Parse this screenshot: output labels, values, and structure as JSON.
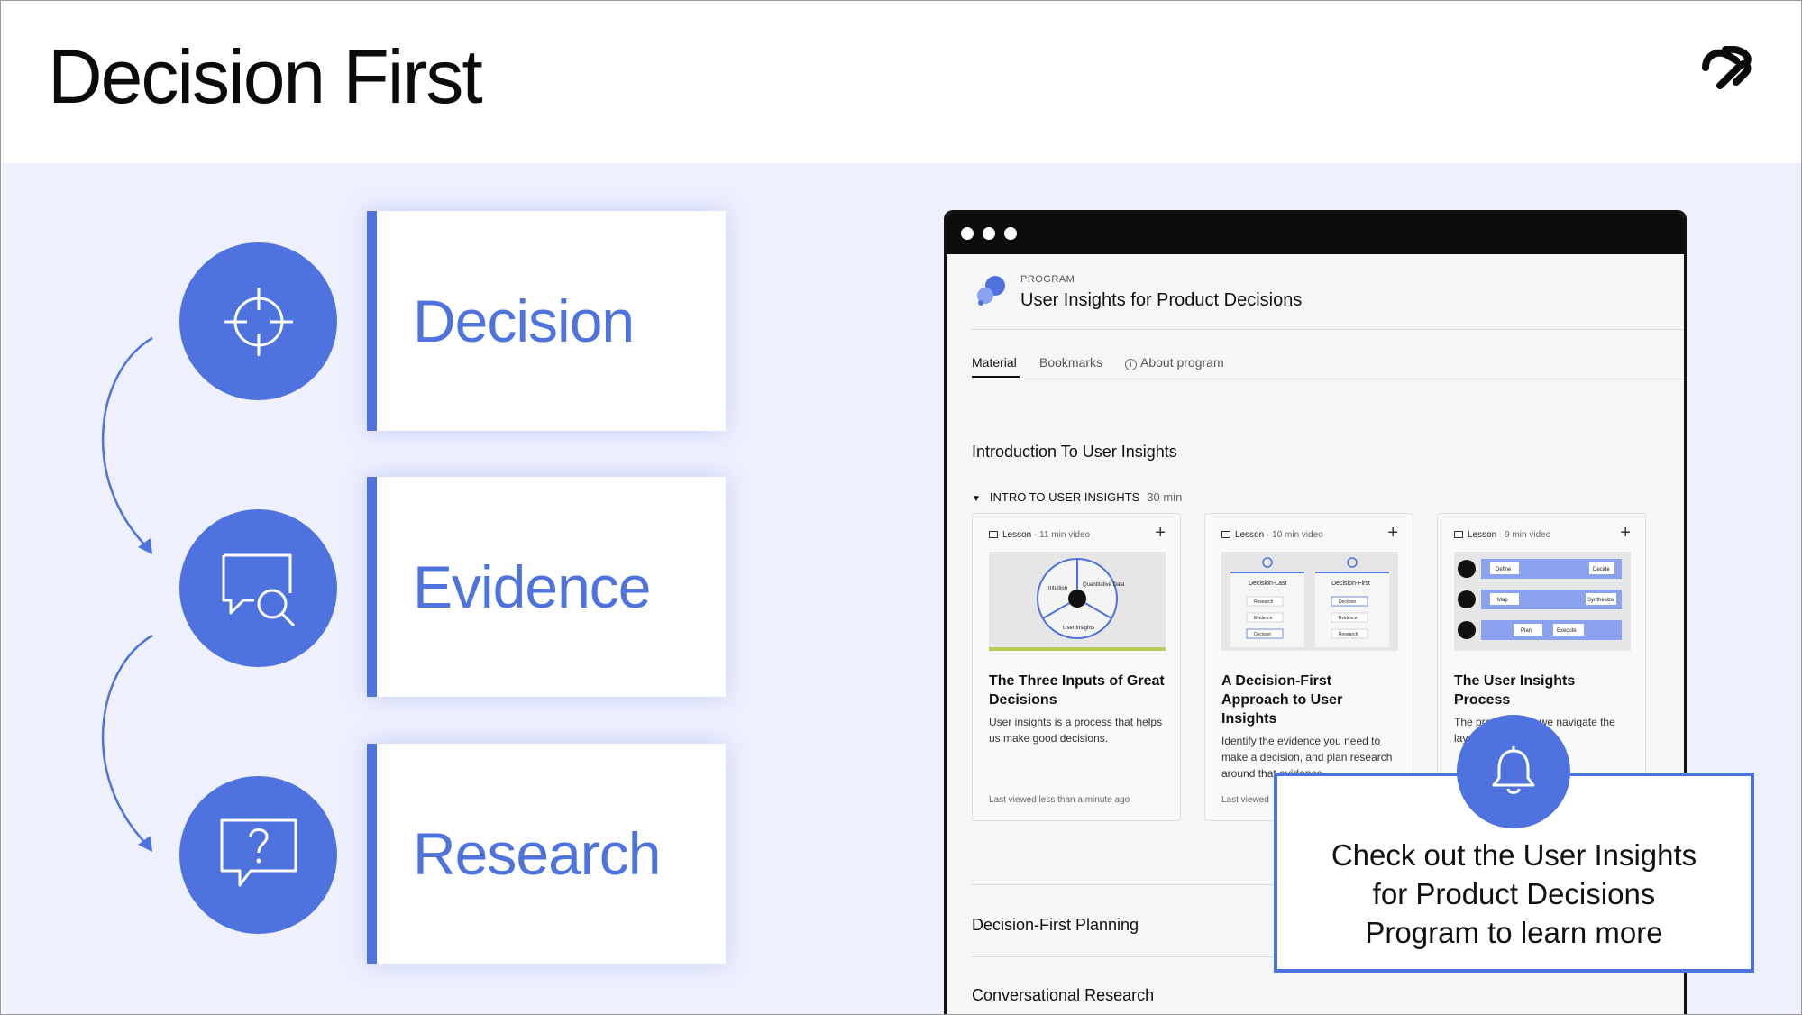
{
  "slide": {
    "title": "Decision First",
    "brand_color": "#4e73de",
    "background_color": "#eef0fd"
  },
  "steps": [
    {
      "label": "Decision",
      "icon": "crosshair-icon"
    },
    {
      "label": "Evidence",
      "icon": "chat-search-icon"
    },
    {
      "label": "Research",
      "icon": "question-chat-icon"
    }
  ],
  "browser": {
    "program_kicker": "PROGRAM",
    "program_title": "User Insights for Product Decisions",
    "tabs": [
      "Material",
      "Bookmarks",
      "About program"
    ],
    "active_tab": "Material",
    "section_title": "Introduction To User Insights",
    "sub_section": {
      "label": "INTRO TO USER INSIGHTS",
      "duration": "30 min"
    },
    "lessons": [
      {
        "kind": "Lesson",
        "length": "· 11 min video",
        "title": "The Three Inputs of Great Decisions",
        "description": "User insights is a process that helps us make good decisions.",
        "footer": "Last viewed less than a minute ago",
        "thumb_labels": [
          "Intuition",
          "Quantitative Data",
          "User Insights"
        ]
      },
      {
        "kind": "Lesson",
        "length": "· 10 min video",
        "title": "A Decision-First Approach to User Insights",
        "description": "Identify the evidence you need to make a decision, and plan research around that evidence.",
        "footer": "Last viewed",
        "thumb_labels": [
          "Decision-Last",
          "Research",
          "Evidence",
          "Decision",
          "Decision-First",
          "Decision",
          "Evidence",
          "Research"
        ]
      },
      {
        "kind": "Lesson",
        "length": "· 9 min video",
        "title": "The User Insights Process",
        "description": "The process how we navigate the layers to user insights.",
        "footer": "",
        "thumb_labels": [
          "Define",
          "Decide",
          "Map",
          "Synthesize",
          "Plan",
          "Execute"
        ]
      }
    ],
    "rows": [
      "Decision-First Planning",
      "Conversational Research"
    ]
  },
  "callout": {
    "line1": "Check out the User Insights",
    "line2": "for Product Decisions",
    "line3": "Program to learn more",
    "icon": "bell-icon"
  }
}
